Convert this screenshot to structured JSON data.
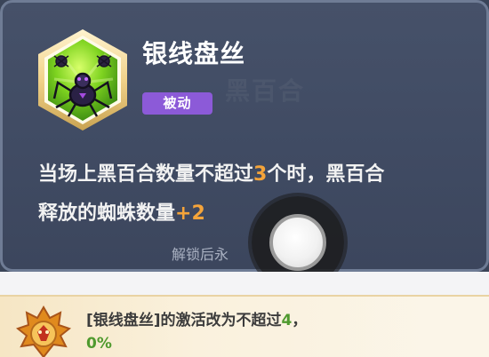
{
  "skill": {
    "title": "银线盘丝",
    "tag": "被动",
    "icon": "spider-skill-icon",
    "description": {
      "line1_prefix": "当场上黑百合数量不超过",
      "line1_value": "3",
      "line1_suffix": "个时，黑百合",
      "line2_prefix": "释放的蜘蛛数量",
      "line2_value": "+2"
    },
    "unlock_note": "解锁后永",
    "ghost_text": "黑百合"
  },
  "upgrade": {
    "icon": "golden-crest-icon",
    "text_prefix": "[银线盘丝]的激活改为不超过",
    "text_value": "4",
    "text_suffix": "，",
    "line2": "0%"
  },
  "colors": {
    "panel_bg": "#434e66",
    "panel_border": "#6f7c95",
    "highlight": "#f5a43a",
    "badge": "#8c5ad8",
    "upgrade_bg": "#faf1dd",
    "upgrade_value": "#4f9a2e"
  }
}
